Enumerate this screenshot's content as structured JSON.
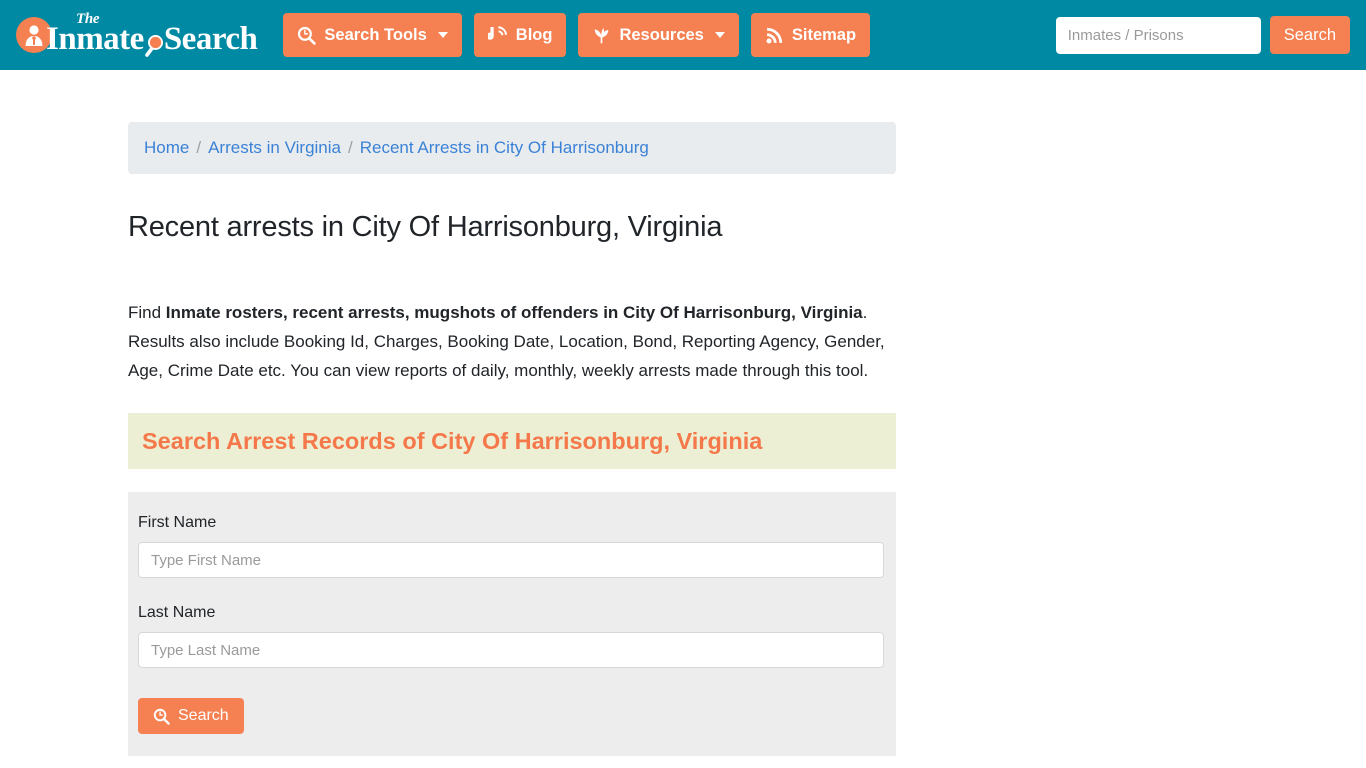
{
  "header": {
    "logo": {
      "the": "The",
      "word1": "Inmate",
      "word2": "Search",
      "badge_icon": "person-icon",
      "mag_icon": "magnifier-icon"
    },
    "nav": [
      {
        "label": "Search Tools",
        "icon": "magnifier-clock-icon",
        "has_caret": true
      },
      {
        "label": "Blog",
        "icon": "blogger-rss-icon",
        "has_caret": false
      },
      {
        "label": "Resources",
        "icon": "leaf-icon",
        "has_caret": true
      },
      {
        "label": "Sitemap",
        "icon": "rss-icon",
        "has_caret": false
      }
    ],
    "search": {
      "placeholder": "Inmates / Prisons",
      "value": "",
      "button_label": "Search"
    },
    "colors": {
      "bar_background": "#0089A3",
      "accent_orange": "#F58152"
    }
  },
  "breadcrumb": {
    "items": [
      "Home",
      "Arrests in Virginia",
      "Recent Arrests in City Of Harrisonburg"
    ],
    "separator": "/"
  },
  "main": {
    "page_title": "Recent arrests in City Of Harrisonburg, Virginia",
    "lead": {
      "prefix": "Find ",
      "bold": "Inmate rosters, recent arrests, mugshots of offenders in City Of Harrisonburg, Virginia",
      "suffix": ". Results also include Booking Id, Charges, Booking Date, Location, Bond, Reporting Agency, Gender, Age, Crime Date etc. You can view reports of daily, monthly, weekly arrests made through this tool."
    },
    "banner": {
      "title": "Search Arrest Records of City Of Harrisonburg, Virginia",
      "background": "#EDEFD4",
      "text_color": "#F4784A"
    },
    "form": {
      "first_name": {
        "label": "First Name",
        "placeholder": "Type First Name",
        "value": ""
      },
      "last_name": {
        "label": "Last Name",
        "placeholder": "Type Last Name",
        "value": ""
      },
      "submit": {
        "label": "Search",
        "icon": "magnifier-clock-icon"
      }
    }
  }
}
